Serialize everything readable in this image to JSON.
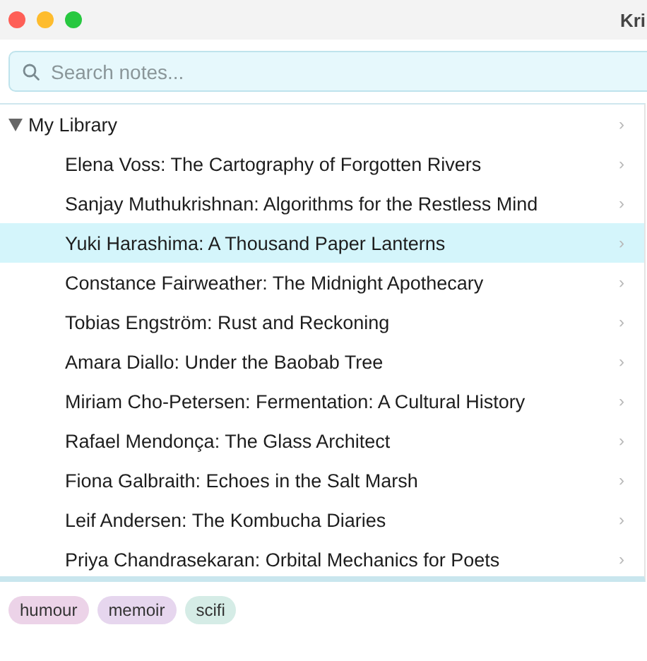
{
  "window": {
    "title": "Kri"
  },
  "search": {
    "placeholder": "Search notes..."
  },
  "tree": [
    {
      "label": "My Library",
      "expanded": true,
      "selected": false,
      "chevron": "›",
      "children": [
        {
          "label": "Elena Voss: The Cartography of Forgotten Rivers",
          "selected": false,
          "chevron": "›"
        },
        {
          "label": "Sanjay Muthukrishnan: Algorithms for the Restless Mind",
          "selected": false,
          "chevron": "›"
        },
        {
          "label": "Yuki Harashima: A Thousand Paper Lanterns",
          "selected": true,
          "chevron": "›"
        },
        {
          "label": "Constance Fairweather: The Midnight Apothecary",
          "selected": false,
          "chevron": "›"
        },
        {
          "label": "Tobias Engström: Rust and Reckoning",
          "selected": false,
          "chevron": "›"
        },
        {
          "label": "Amara Diallo: Under the Baobab Tree",
          "selected": false,
          "chevron": "›"
        },
        {
          "label": "Miriam Cho-Petersen: Fermentation: A Cultural History",
          "selected": false,
          "chevron": "›"
        },
        {
          "label": "Rafael Mendonça: The Glass Architect",
          "selected": false,
          "chevron": "›"
        },
        {
          "label": "Fiona Galbraith: Echoes in the Salt Marsh",
          "selected": false,
          "chevron": "›"
        },
        {
          "label": "Leif Andersen: The Kombucha Diaries",
          "selected": false,
          "chevron": "›"
        },
        {
          "label": "Priya Chandrasekaran: Orbital Mechanics for Poets",
          "selected": false,
          "chevron": "›"
        }
      ]
    }
  ],
  "tags": [
    {
      "label": "humour",
      "color": "#ecd3e8"
    },
    {
      "label": "memoir",
      "color": "#e6d6ee"
    },
    {
      "label": "scifi",
      "color": "#d5ece6"
    }
  ]
}
